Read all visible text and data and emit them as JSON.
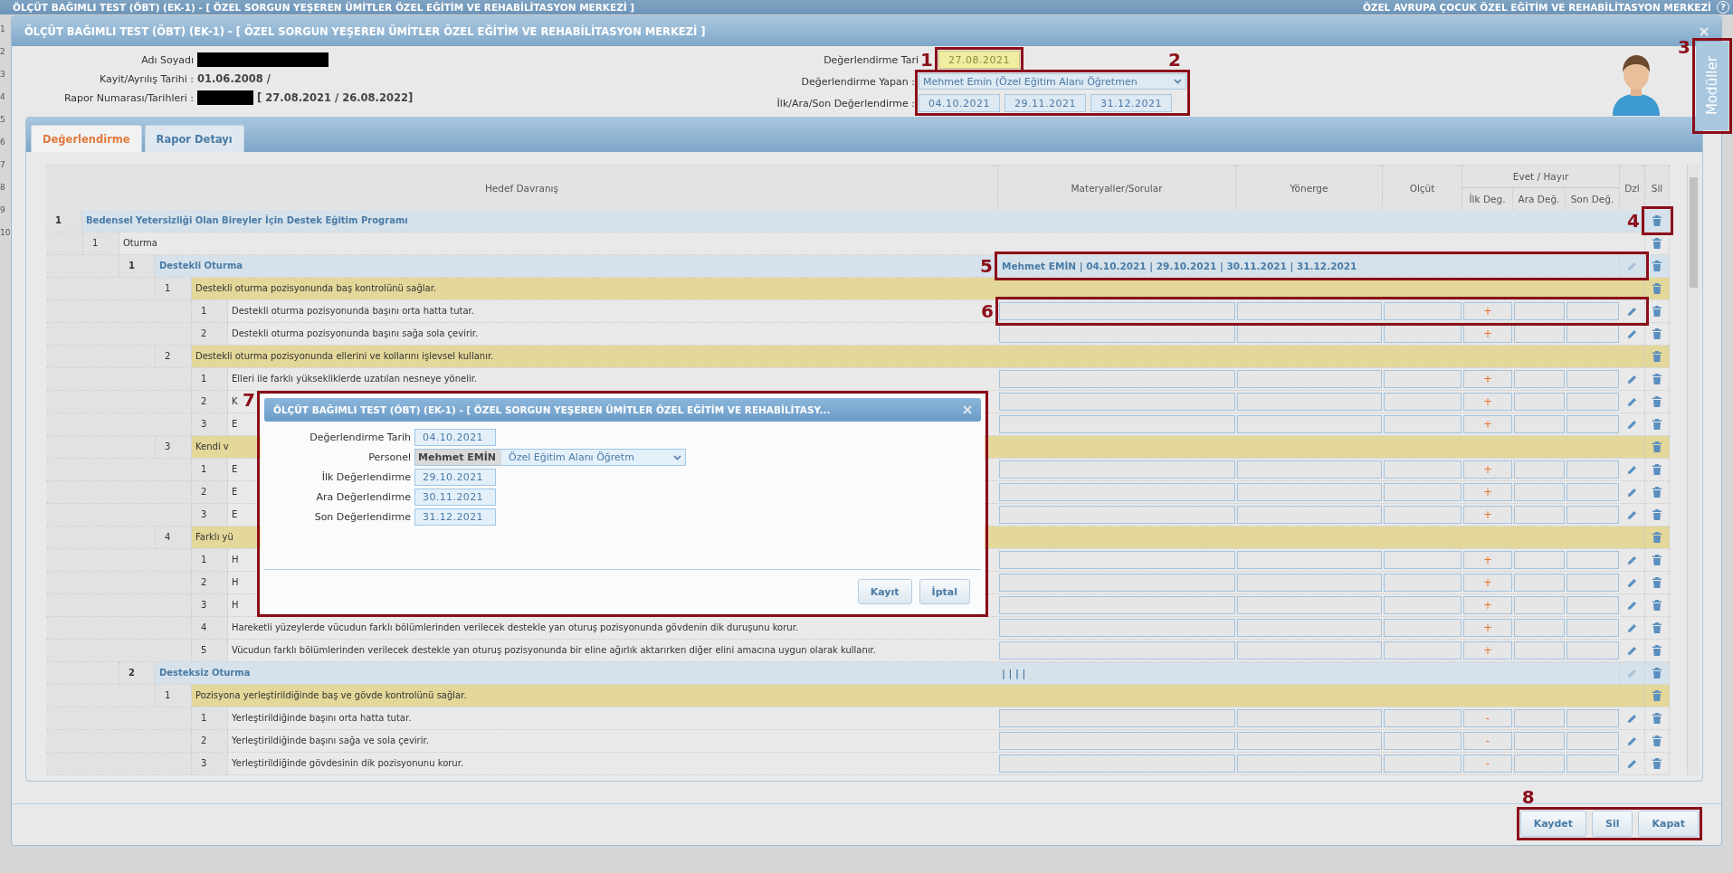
{
  "backdrop": {
    "title": "ÖLÇÜT BAĞIMLI TEST (ÖBT) (EK-1) - [ ÖZEL SORGUN YEŞEREN ÜMİTLER ÖZEL EĞİTİM VE REHABİLİTASYON MERKEZİ ]",
    "institution": "ÖZEL AVRUPA ÇOCUK ÖZEL EĞİTİM VE REHABİLİTASYON MERKEZİ",
    "help": "?",
    "row_numbers": [
      "1",
      "2",
      "3",
      "4",
      "5",
      "6",
      "7",
      "8",
      "9",
      "10"
    ]
  },
  "window": {
    "title": "ÖLÇÜT BAĞIMLI TEST (ÖBT) (EK-1) - [ ÖZEL SORGUN YEŞEREN ÜMİTLER ÖZEL EĞİTİM VE REHABİLİTASYON MERKEZİ ]"
  },
  "student": [
    {
      "label": "Adı Soyadı",
      "redacted": true
    },
    {
      "label": "Kayit/Ayrılış Tarihi :",
      "value": "01.06.2008 /"
    },
    {
      "label": "Rapor Numarası/Tarihleri :",
      "redacted": true,
      "value": "[ 27.08.2021 / 26.08.2022]"
    }
  ],
  "evaluation": {
    "date_label": "Değerlendirme Tari",
    "date": {
      "value": "27.08.2021",
      "highlighted": true,
      "callout": "1"
    },
    "evaluator_label": "Değerlendirme Yapan :",
    "evaluator": "Mehmet Emin (Özel Eğitim Alanı Öğretmen",
    "dates_label": "İlk/Ara/Son Değerlendirme :",
    "dates": [
      "04.10.2021",
      "29.11.2021",
      "31.12.2021"
    ],
    "callout": "2"
  },
  "modules_tab": {
    "label": "Modüller",
    "callout": "3"
  },
  "tabs": [
    {
      "label": "Değerlendirme",
      "selected": true
    },
    {
      "label": "Rapor Detayı",
      "selected": false
    }
  ],
  "table": {
    "columns": [
      {
        "label": "Hedef Davranış"
      },
      {
        "label": "Materyaller/Sorular"
      },
      {
        "label": "Yönerge"
      },
      {
        "label": "Olçüt"
      },
      {
        "label": "Evet / Hayır",
        "children": [
          {
            "label": "İlk Deg."
          },
          {
            "label": "Ara Değ."
          },
          {
            "label": "Son Değ."
          }
        ]
      },
      {
        "label": "Dzl"
      },
      {
        "label": "Sil"
      }
    ],
    "rows": [
      {
        "number": "1",
        "text": "Bedensel Yetersizliği Olan Bireyler İçin Destek Eğitim Programı",
        "callout": "4",
        "children": [
          {
            "number": "1",
            "text": "Oturma",
            "children": [
              {
                "number": "1",
                "text": "Destekli Oturma",
                "summary": "Mehmet EMİN | 04.10.2021 | 29.10.2021 | 30.11.2021 | 31.12.2021",
                "callout": "5",
                "children": [
                  {
                    "number": "1",
                    "text": "Destekli oturma pozisyonunda baş kontrolünü sağlar.",
                    "children": [
                      {
                        "number": "1",
                        "text": "Destekli oturma pozisyonunda başını orta hatta tutar.",
                        "first_mark": "+",
                        "callout": "6"
                      },
                      {
                        "number": "2",
                        "text": "Destekli oturma pozisyonunda başını sağa sola çevirir.",
                        "first_mark": "+"
                      }
                    ]
                  },
                  {
                    "number": "2",
                    "text": "Destekli oturma pozisyonunda ellerini ve kollarını işlevsel kullanır.",
                    "children": [
                      {
                        "number": "1",
                        "text": "Elleri ile farklı yüksekliklerde uzatılan nesneye yönelir.",
                        "first_mark": "+"
                      },
                      {
                        "number": "2",
                        "text": "K",
                        "first_mark": "+"
                      },
                      {
                        "number": "3",
                        "text": "E",
                        "first_mark": "+"
                      }
                    ]
                  },
                  {
                    "number": "3",
                    "text": "Kendi v",
                    "children": [
                      {
                        "number": "1",
                        "text": "E",
                        "first_mark": "+"
                      },
                      {
                        "number": "2",
                        "text": "E",
                        "first_mark": "+"
                      },
                      {
                        "number": "3",
                        "text": "E",
                        "first_mark": "+"
                      }
                    ]
                  },
                  {
                    "number": "4",
                    "text": "Farklı yü",
                    "children": [
                      {
                        "number": "1",
                        "text": "H",
                        "first_mark": "+"
                      },
                      {
                        "number": "2",
                        "text": "H",
                        "first_mark": "+"
                      },
                      {
                        "number": "3",
                        "text": "H",
                        "first_mark": "+"
                      },
                      {
                        "number": "4",
                        "text": "Hareketli yüzeylerde vücudun farklı bölümlerinden verilecek destekle yan oturuş pozisyonunda gövdenin dik duruşunu korur.",
                        "first_mark": "+"
                      },
                      {
                        "number": "5",
                        "text": "Vücudun farklı bölümlerinden verilecek destekle yan oturuş pozisyonunda bir eline ağırlık aktarırken diğer elini amacına uygun olarak kullanır.",
                        "first_mark": "+"
                      }
                    ]
                  }
                ]
              },
              {
                "number": "2",
                "text": "Desteksiz Oturma",
                "summary": "| | | |",
                "children": [
                  {
                    "number": "1",
                    "text": "Pozisyona yerleştirildiğinde baş ve gövde kontrolünü sağlar.",
                    "children": [
                      {
                        "number": "1",
                        "text": "Yerleştirildiğinde başını orta hatta tutar.",
                        "first_mark": "-"
                      },
                      {
                        "number": "2",
                        "text": "Yerleştirildiğinde başını sağa ve sola çevirir.",
                        "first_mark": "-"
                      },
                      {
                        "number": "3",
                        "text": "Yerleştirildiğinde gövdesinin dik pozisyonunu korur.",
                        "first_mark": "-"
                      }
                    ]
                  }
                ]
              }
            ]
          }
        ]
      }
    ]
  },
  "dialog": {
    "title": "ÖLÇÜT BAĞIMLI TEST (ÖBT) (EK-1) - [ ÖZEL SORGUN YEŞEREN ÜMİTLER ÖZEL EĞİTİM VE REHABİLİTASY...",
    "callout": "7",
    "fields": [
      {
        "label": "Değerlendirme Tarih",
        "kind": "date",
        "value": "04.10.2021"
      },
      {
        "label": "Personel",
        "kind": "select",
        "value": "Mehmet EMİN",
        "detail": "Özel Eğitim Alanı Öğretm"
      },
      {
        "label": "İlk Değerlendirme",
        "kind": "date",
        "value": "29.10.2021"
      },
      {
        "label": "Ara Değerlendirme",
        "kind": "date",
        "value": "30.11.2021"
      },
      {
        "label": "Son Değerlendirme",
        "kind": "date",
        "value": "31.12.2021"
      }
    ],
    "buttons": [
      "Kayıt",
      "İptal"
    ]
  },
  "footer": {
    "buttons": [
      "Kaydet",
      "Sil",
      "Kapat"
    ],
    "callout": "8"
  }
}
